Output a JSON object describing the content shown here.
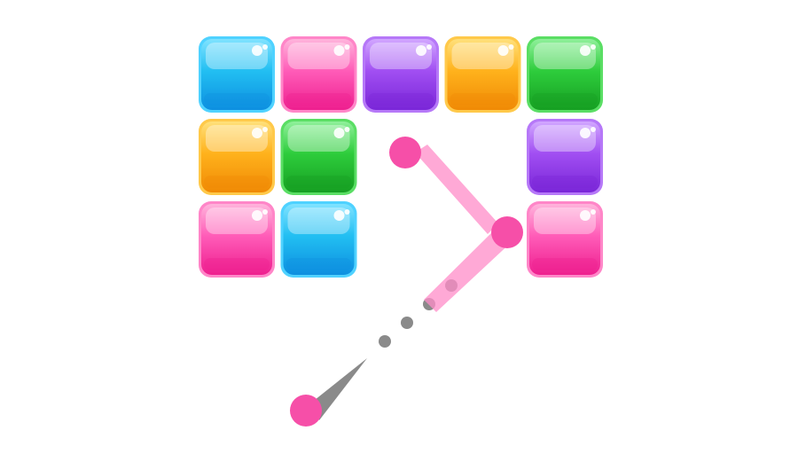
{
  "game": {
    "grid": {
      "rows": 3,
      "cols": 5
    },
    "palette": {
      "cyan": {
        "light": "#7fe3ff",
        "mid": "#22bff2",
        "dark": "#0d8fe0",
        "edge": "#4fd2ff"
      },
      "pink": {
        "light": "#ffb3dc",
        "mid": "#ff5cb8",
        "dark": "#ee1f8f",
        "edge": "#ff86c8"
      },
      "purple": {
        "light": "#d1a6ff",
        "mid": "#a14ff2",
        "dark": "#7a26d8",
        "edge": "#b678f8"
      },
      "orange": {
        "light": "#ffe07a",
        "mid": "#ffb21c",
        "dark": "#f08a05",
        "edge": "#ffc94a"
      },
      "green": {
        "light": "#8ff09a",
        "mid": "#2ecd3c",
        "dark": "#169f22",
        "edge": "#5ade64"
      }
    },
    "blocks": [
      {
        "row": 0,
        "col": 0,
        "color": "cyan"
      },
      {
        "row": 0,
        "col": 1,
        "color": "pink"
      },
      {
        "row": 0,
        "col": 2,
        "color": "purple"
      },
      {
        "row": 0,
        "col": 3,
        "color": "orange"
      },
      {
        "row": 0,
        "col": 4,
        "color": "green"
      },
      {
        "row": 1,
        "col": 0,
        "color": "orange"
      },
      {
        "row": 1,
        "col": 1,
        "color": "green"
      },
      {
        "row": 1,
        "col": 4,
        "color": "purple"
      },
      {
        "row": 2,
        "col": 0,
        "color": "pink"
      },
      {
        "row": 2,
        "col": 1,
        "color": "cyan"
      },
      {
        "row": 2,
        "col": 4,
        "color": "pink"
      }
    ],
    "ball_color": "#f64fa8",
    "trail_color": "#ff8cc8",
    "aim_color": "#8a8a8a",
    "aim_dot_count": 4
  }
}
